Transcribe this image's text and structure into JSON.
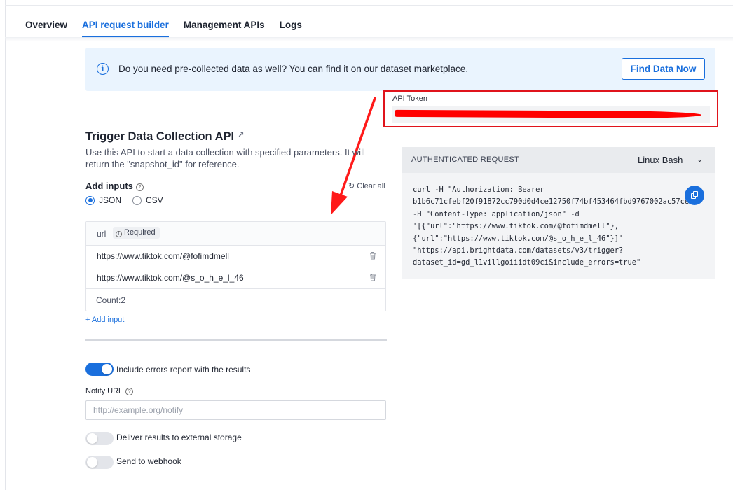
{
  "tabs": [
    {
      "label": "Overview",
      "active": false
    },
    {
      "label": "API request builder",
      "active": true
    },
    {
      "label": "Management APIs",
      "active": false
    },
    {
      "label": "Logs",
      "active": false
    }
  ],
  "banner": {
    "message": "Do you need pre-collected data as well? You can find it on our dataset marketplace.",
    "button_label": "Find Data Now",
    "icon": "info-icon"
  },
  "api_token": {
    "label": "API Token",
    "value": "",
    "redacted": true,
    "annotation_color": "#e0141c"
  },
  "section": {
    "title": "Trigger Data Collection API",
    "title_icon": "external-link-icon",
    "description": "Use this API to start a data collection with specified parameters. It will return the \"snapshot_id\" for reference."
  },
  "inputs": {
    "label": "Add inputs",
    "clear_all_label": "Clear all",
    "formats": [
      {
        "label": "JSON",
        "selected": true
      },
      {
        "label": "CSV",
        "selected": false
      }
    ],
    "column": "url",
    "required_label": "Required",
    "rows": [
      "https://www.tiktok.com/@fofimdmell",
      "https://www.tiktok.com/@s_o_h_e_l_46"
    ],
    "count_label": "Count:",
    "count": "2",
    "add_input_label": "+ Add input"
  },
  "options": {
    "include_errors": {
      "label": "Include errors report with the results",
      "on": true
    },
    "notify_url": {
      "label": "Notify URL",
      "placeholder": "http://example.org/notify",
      "value": ""
    },
    "external_storage": {
      "label": "Deliver results to external storage",
      "on": false
    },
    "webhook": {
      "label": "Send to webhook",
      "on": false
    }
  },
  "request": {
    "title": "AUTHENTICATED REQUEST",
    "language": "Linux Bash",
    "code_lines": [
      "curl -H \"Authorization: Bearer",
      "b1b6c71cfebf20f91872cc790d0d4ce12750f74bf453464fbd9767002ac57ce\"",
      "-H \"Content-Type: application/json\" -d",
      "'[{\"url\":\"https://www.tiktok.com/@fofimdmell\"},",
      "{\"url\":\"https://www.tiktok.com/@s_o_h_e_l_46\"}]'",
      "\"https://api.brightdata.com/datasets/v3/trigger?",
      "dataset_id=gd_l1villgoiiidt09ci&include_errors=true\""
    ]
  },
  "colors": {
    "accent": "#1a6fdd",
    "banner_bg": "#eaf4fe",
    "annotation_red": "#e0141c"
  }
}
